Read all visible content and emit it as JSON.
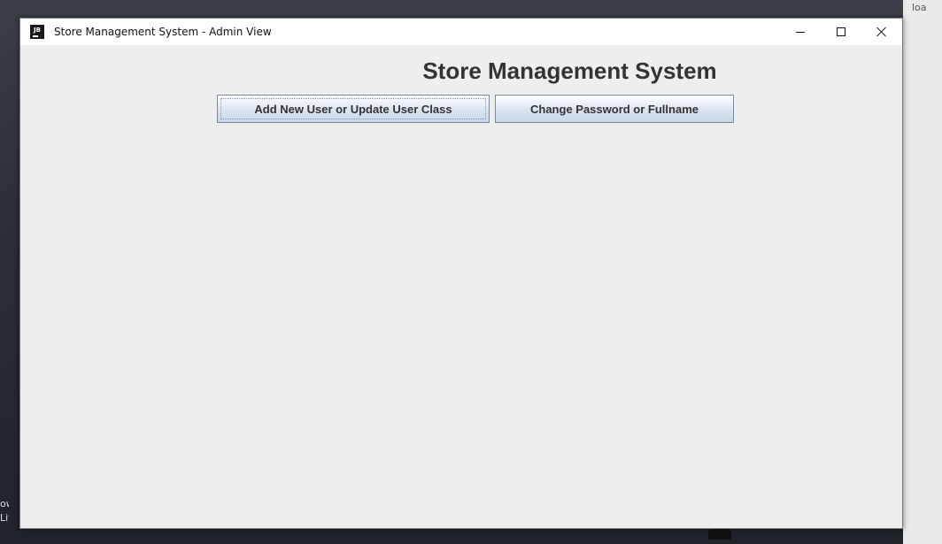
{
  "window": {
    "title": "Store Management System - Admin View",
    "app_icon_text": "JB",
    "app_icon": "java-app-icon",
    "controls": {
      "minimize_icon": "minimize-icon",
      "maximize_icon": "maximize-icon",
      "close_icon": "close-icon"
    }
  },
  "main": {
    "heading": "Store Management System",
    "buttons": {
      "add_user_label": "Add New User or Update User Class",
      "change_password_label": "Change Password or Fullname"
    }
  },
  "desktop": {
    "right_fragment": "loa",
    "left_fragment_1": "ow",
    "left_fragment_2": "Lit"
  }
}
